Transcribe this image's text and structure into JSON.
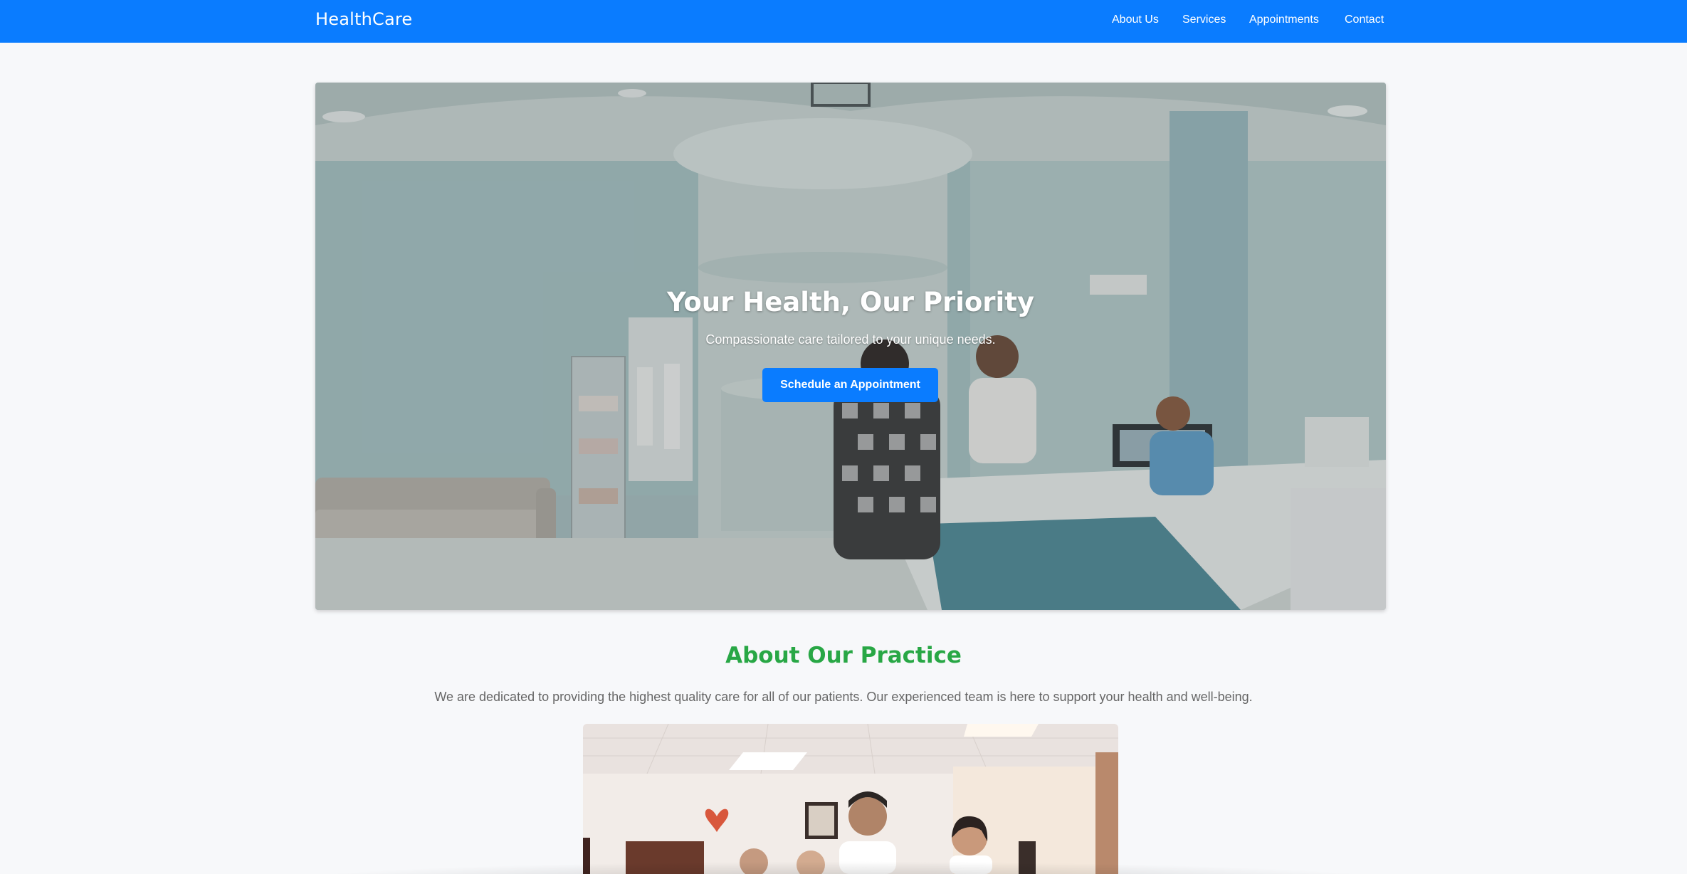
{
  "navbar": {
    "brand": "HealthCare",
    "links": [
      "About Us",
      "Services",
      "Appointments",
      "Contact"
    ],
    "background_color": "#0a7cff"
  },
  "hero": {
    "title": "Your Health, Our Priority",
    "subtitle": "Compassionate care tailored to your unique needs.",
    "button_label": "Schedule an Appointment"
  },
  "about": {
    "title": "About Our Practice",
    "text": "We are dedicated to providing the highest quality care for all of our patients. Our experienced team is here to support your health and well-being.",
    "title_color": "#28a745"
  }
}
